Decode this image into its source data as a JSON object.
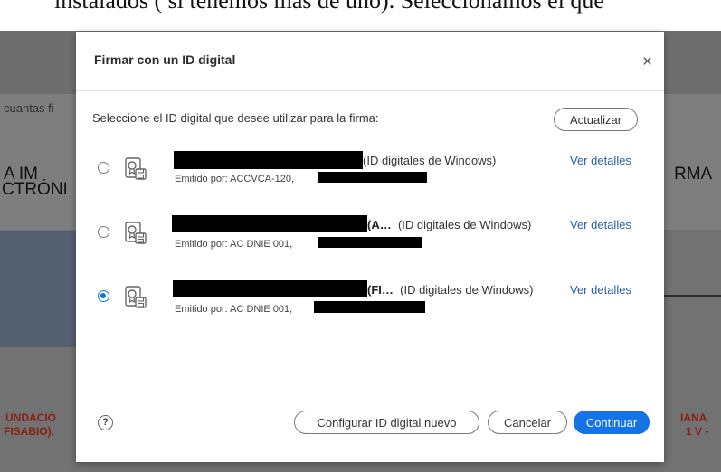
{
  "background": {
    "top_text": "instalados ( si tenemos más de uno). Seleccionamos el que",
    "left_snippet": "cuantas fi",
    "big_left_1": "A   IM",
    "big_left_2": "CTRÓNI",
    "big_right": "RMA",
    "red_left_1": "UNDACIÓ",
    "red_left_2": "FISABIO).",
    "red_right_1": "IANA",
    "red_right_2": "1 V -"
  },
  "dialog": {
    "title": "Firmar con un ID digital",
    "close_glyph": "×",
    "prompt": "Seleccione el ID digital que desee utilizar para la firma:",
    "refresh_label": "Actualizar",
    "ids": [
      {
        "selected": false,
        "name_suffix": "",
        "source": "(ID digitales de Windows)",
        "issuer": "Emitido por: ACCVCA-120,",
        "details": "Ver detalles"
      },
      {
        "selected": false,
        "name_suffix": "(A…",
        "source": "(ID digitales de Windows)",
        "issuer": "Emitido por: AC DNIE 001,",
        "details": "Ver detalles"
      },
      {
        "selected": true,
        "name_suffix": "(FI…",
        "source": "(ID digitales de Windows)",
        "issuer": "Emitido por: AC DNIE 001,",
        "details": "Ver detalles"
      }
    ],
    "help_glyph": "?",
    "configure_label": "Configurar ID digital nuevo",
    "cancel_label": "Cancelar",
    "continue_label": "Continuar",
    "accent_color": "#1473e6"
  }
}
